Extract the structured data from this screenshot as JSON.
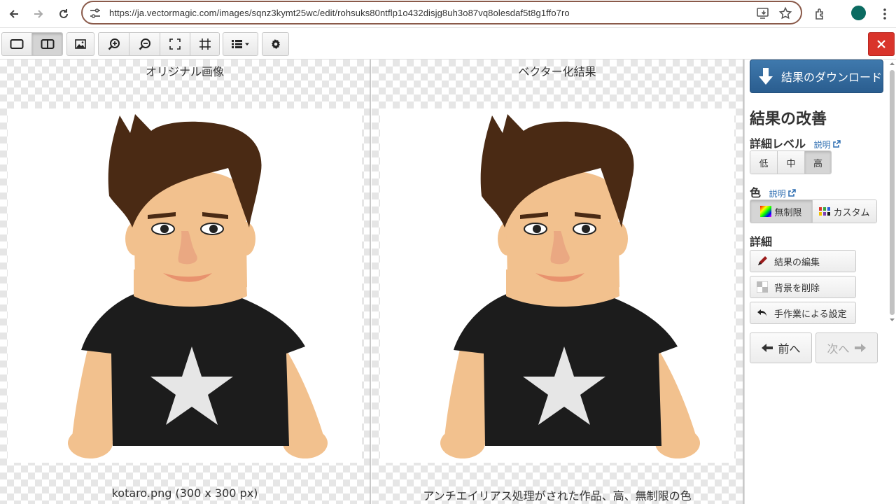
{
  "browser": {
    "url": "https://ja.vectormagic.com/images/sqnz3kymt25wc/edit/rohsuks80ntflp1o432disjg8uh3o87vq8olesdaf5t8g1ffo7ro"
  },
  "panels": {
    "left": {
      "title": "オリジナル画像",
      "caption": "kotaro.png (300 x 300 px)"
    },
    "right": {
      "title": "ベクター化結果",
      "caption": "アンチエイリアス処理がされた作品、高、無制限の色"
    }
  },
  "sidebar": {
    "download_label": "結果のダウンロード",
    "improve_title": "結果の改善",
    "detail_level": {
      "title": "詳細レベル",
      "help_link": "説明",
      "options": [
        "低",
        "中",
        "高"
      ],
      "selected": "高"
    },
    "color": {
      "title": "色",
      "help_link": "説明",
      "options": [
        "無制限",
        "カスタム"
      ],
      "selected": "無制限"
    },
    "details": {
      "title": "詳細",
      "buttons": [
        "結果の編集",
        "背景を削除",
        "手作業による設定"
      ]
    },
    "prev_label": "前へ",
    "next_label": "次へ"
  },
  "colors": {
    "download_bg": "#2a5d8f",
    "close_bg": "#d9342b",
    "hair": "#4a2a14",
    "skin": "#f2c18e",
    "shirt": "#1c1c1c",
    "star": "#e6e6e6"
  }
}
